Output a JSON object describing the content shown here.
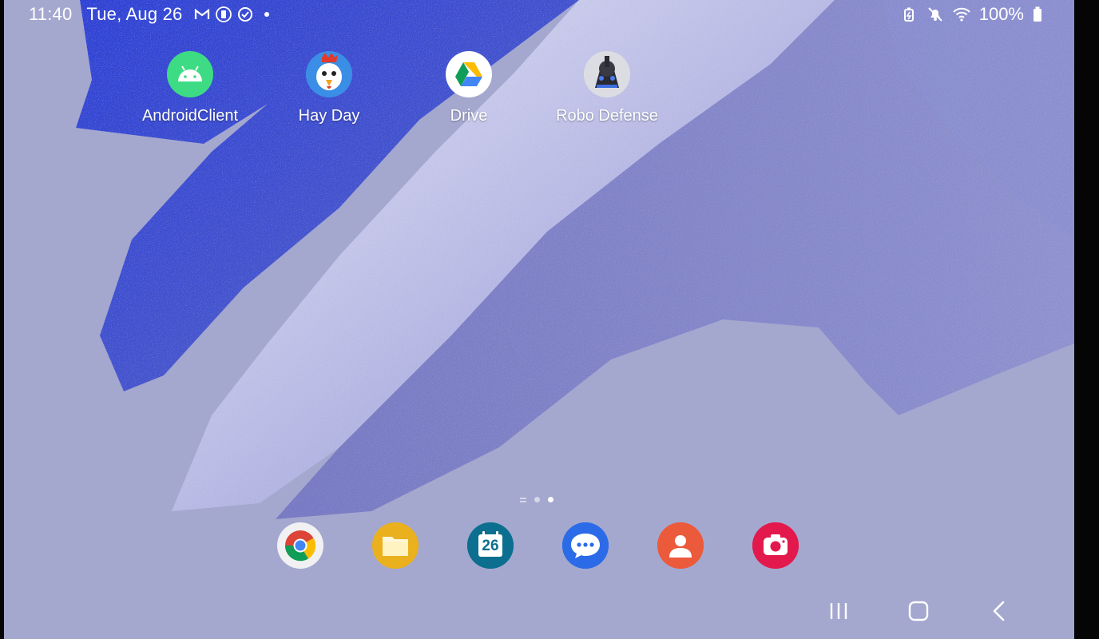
{
  "status_bar": {
    "time": "11:40",
    "date": "Tue, Aug 26",
    "battery": "100%",
    "notification_icons": [
      "gmail-icon",
      "vibrate-icon",
      "sync-icon",
      "more-dot-icon"
    ],
    "system_icons": [
      "battery-saver-icon",
      "mute-icon",
      "wifi-icon",
      "battery-icon"
    ]
  },
  "home_apps": [
    {
      "label": "AndroidClient",
      "icon": "android-icon"
    },
    {
      "label": "Hay Day",
      "icon": "hay-day-icon"
    },
    {
      "label": "Drive",
      "icon": "drive-icon"
    },
    {
      "label": "Robo Defense",
      "icon": "robo-defense-icon"
    }
  ],
  "page_indicator": {
    "pages": 2,
    "active_page": 2
  },
  "dock": [
    {
      "name": "chrome",
      "icon": "chrome-icon"
    },
    {
      "name": "my-files",
      "icon": "folder-icon"
    },
    {
      "name": "calendar",
      "icon": "calendar-icon",
      "text": "26"
    },
    {
      "name": "messages",
      "icon": "messages-icon"
    },
    {
      "name": "contacts",
      "icon": "contacts-icon"
    },
    {
      "name": "camera",
      "icon": "camera-icon"
    }
  ],
  "nav_bar": [
    "recents-icon",
    "home-icon",
    "back-icon"
  ],
  "colors": {
    "wallpaper_base": "#a4a8cf",
    "stroke_blue": "#3a4fd0",
    "stroke_lavender": "#c6c8ea",
    "stroke_violet": "#7a7cc0"
  }
}
